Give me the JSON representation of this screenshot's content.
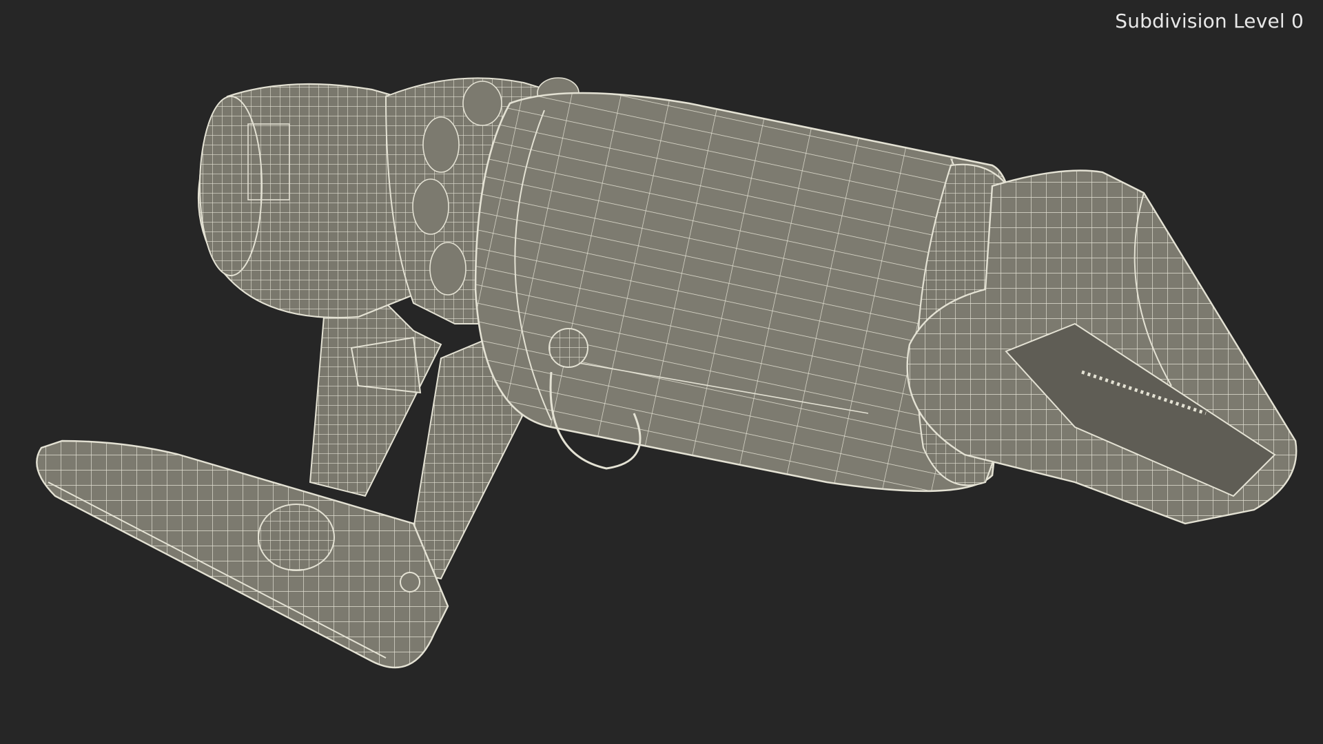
{
  "viewport": {
    "overlay_label": "Subdivision Level 0",
    "background_color": "#262626",
    "mesh_fill_color": "#7c7a6f",
    "mesh_wire_color": "#e4e2d4"
  },
  "model": {
    "icon": "handheld-vacuum-wireframe-icon"
  }
}
